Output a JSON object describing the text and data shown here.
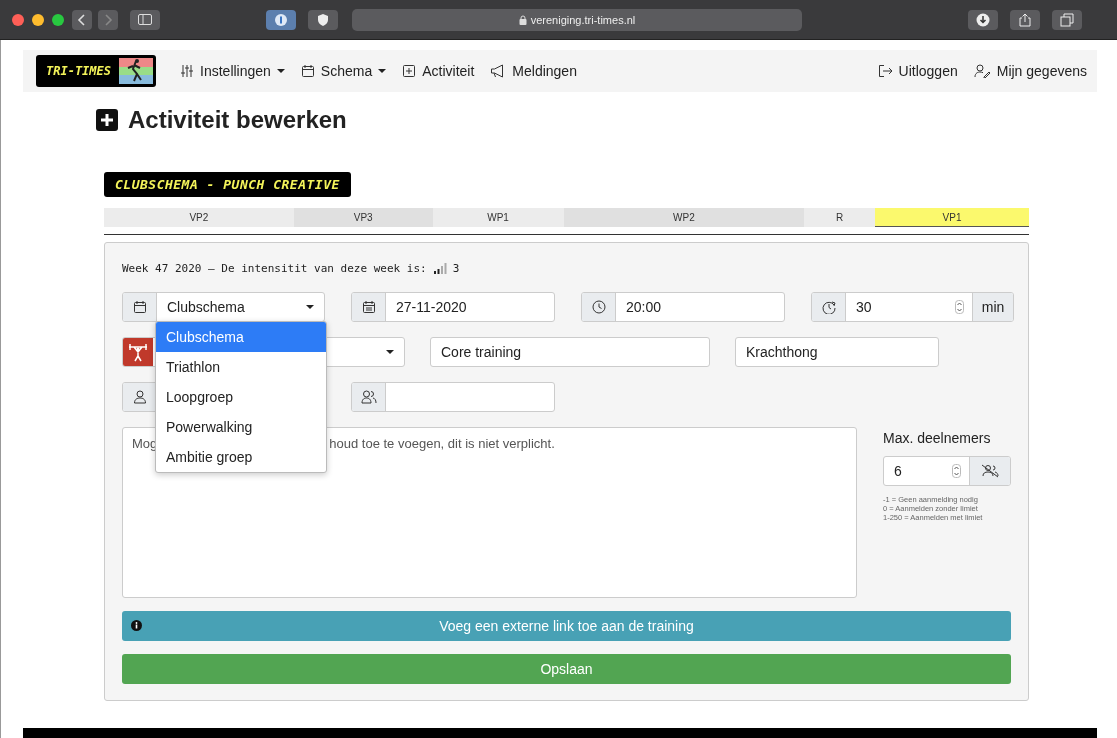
{
  "browser": {
    "url": "vereniging.tri-times.nl"
  },
  "nav": {
    "logo": "TRI-TIMES",
    "items": [
      {
        "label": "Instellingen",
        "dropdown": true
      },
      {
        "label": "Schema",
        "dropdown": true
      },
      {
        "label": "Activiteit",
        "dropdown": false
      },
      {
        "label": "Meldingen",
        "dropdown": false
      }
    ],
    "right": [
      {
        "label": "Uitloggen"
      },
      {
        "label": "Mijn gegevens"
      }
    ]
  },
  "title": "Activiteit bewerken",
  "banner": "CLUBSCHEMA - PUNCH CREATIVE",
  "tabs": [
    {
      "label": "VP2",
      "selected": false
    },
    {
      "label": "VP3",
      "selected": false
    },
    {
      "label": "WP1",
      "selected": false
    },
    {
      "label": "WP2",
      "selected": false
    },
    {
      "label": "R",
      "selected": false
    },
    {
      "label": "VP1",
      "selected": true
    }
  ],
  "week_text": "Week 47 2020 – De intensitit van deze week is:",
  "intensity": "3",
  "group_select": {
    "value": "Clubschema",
    "options": [
      {
        "label": "Clubschema",
        "selected": true
      },
      {
        "label": "Triathlon",
        "selected": false
      },
      {
        "label": "Loopgroep",
        "selected": false
      },
      {
        "label": "Powerwalking",
        "selected": false
      },
      {
        "label": "Ambitie groep",
        "selected": false
      }
    ]
  },
  "date": "27-11-2020",
  "time": "20:00",
  "duration": "30",
  "duration_unit": "min",
  "name": "Core training",
  "category": "Krachthong",
  "description": {
    "placeholder_start": "Mog",
    "placeholder_end": "houd toe te voegen, dit is niet verplicht."
  },
  "max_participants": {
    "label": "Max. deelnemers",
    "value": "6",
    "hints": [
      "-1 = Geen aanmelding nodig",
      "0 = Aanmelden zonder limiet",
      "1-250 = Aanmelden met limiet"
    ]
  },
  "link_button": "Voeg een externe link toe aan de training",
  "save_button": "Opslaan"
}
